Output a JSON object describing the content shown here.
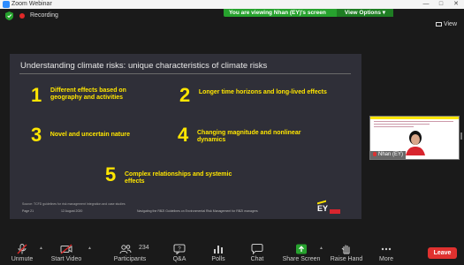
{
  "window": {
    "title": "Zoom Webinar"
  },
  "topbar": {
    "recording_label": "Recording",
    "share_banner_text": "You are viewing Nhan (EY)'s screen",
    "view_options_label": "View Options",
    "view_label": "View"
  },
  "slide": {
    "title": "Understanding climate risks: unique characteristics of climate risks",
    "items": [
      {
        "num": "1",
        "text": "Different effects based on geography and activities"
      },
      {
        "num": "2",
        "text": "Longer time horizons and long-lived effects"
      },
      {
        "num": "3",
        "text": "Novel and uncertain nature"
      },
      {
        "num": "4",
        "text": "Changing magnitude and nonlinear dynamics"
      },
      {
        "num": "5",
        "text": "Complex relationships and systemic effects"
      }
    ],
    "source": "Source: TCFD guidelines for risk management Integration and case studies",
    "footer": {
      "page": "Page 21",
      "date": "12 August 2020",
      "center": "Navigating the RBZI Guidelines on Environmental Risk Management for RBZI managers"
    },
    "logo_text": "EY",
    "accent_yellow": "#ffe600"
  },
  "participant": {
    "name": "Nhan (EY)"
  },
  "toolbar": {
    "unmute": "Unmute",
    "start_video": "Start Video",
    "participants": "Participants",
    "participants_count": "234",
    "qa": "Q&A",
    "polls": "Polls",
    "chat": "Chat",
    "share_screen": "Share Screen",
    "raise_hand": "Raise Hand",
    "more": "More",
    "leave": "Leave"
  },
  "colors": {
    "share_green": "#27a22e",
    "leave_red": "#e0312f",
    "record_red": "#e02828"
  }
}
